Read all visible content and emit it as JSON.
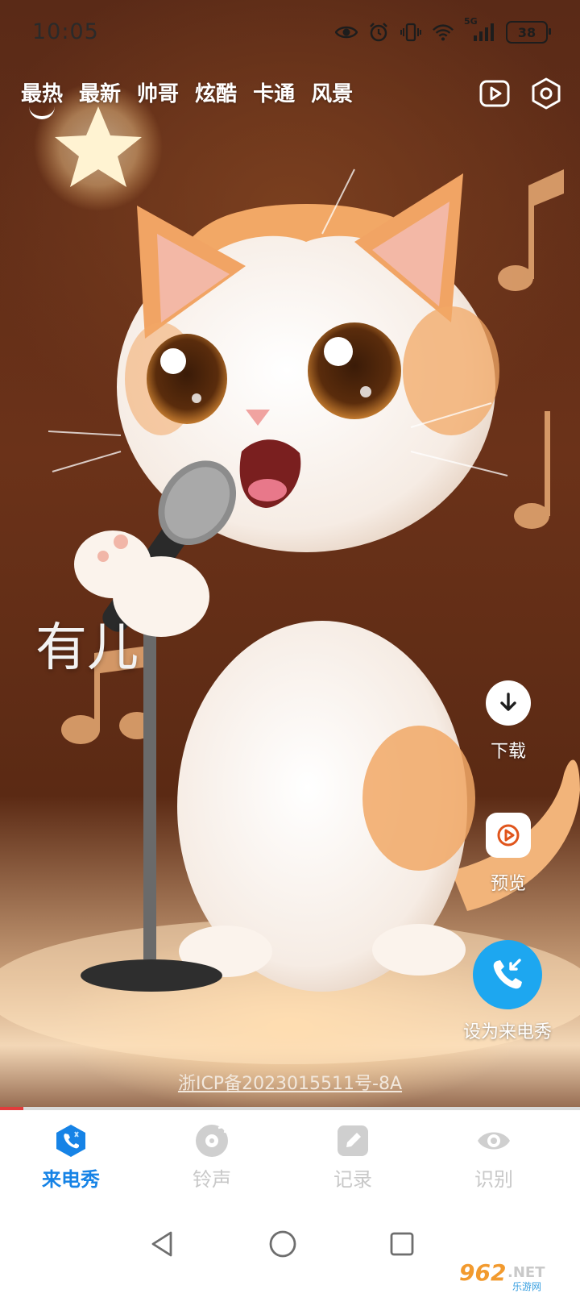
{
  "status_bar": {
    "time": "10:05",
    "network": "5G",
    "battery": "38",
    "icons": [
      "eye-icon",
      "alarm-icon",
      "vibrate-icon",
      "wifi-icon",
      "signal-icon",
      "battery-icon"
    ]
  },
  "tabs": [
    {
      "label": "最热",
      "active": true
    },
    {
      "label": "最新",
      "active": false
    },
    {
      "label": "帅哥",
      "active": false
    },
    {
      "label": "炫酷",
      "active": false
    },
    {
      "label": "卡通",
      "active": false
    },
    {
      "label": "风景",
      "active": false
    }
  ],
  "top_right_icons": [
    "video-library-icon",
    "settings-hexagon-icon"
  ],
  "overlay_title": "有儿",
  "actions": {
    "download": "下载",
    "preview": "预览",
    "set_ringtone": "设为来电秀"
  },
  "icp": "浙ICP备2023015511号-8A",
  "progress": 0.04,
  "bottom_nav": [
    {
      "label": "来电秀",
      "icon": "call-show-icon",
      "active": true
    },
    {
      "label": "铃声",
      "icon": "ringtone-disc-icon",
      "active": false
    },
    {
      "label": "记录",
      "icon": "record-edit-icon",
      "active": false
    },
    {
      "label": "识别",
      "icon": "recognize-eye-icon",
      "active": false
    }
  ],
  "watermark": {
    "brand": "962.NET",
    "sub": "乐游网"
  },
  "colors": {
    "accent": "#1683e6",
    "set_button": "#1da7f0",
    "inactive": "#c8c8c8"
  }
}
